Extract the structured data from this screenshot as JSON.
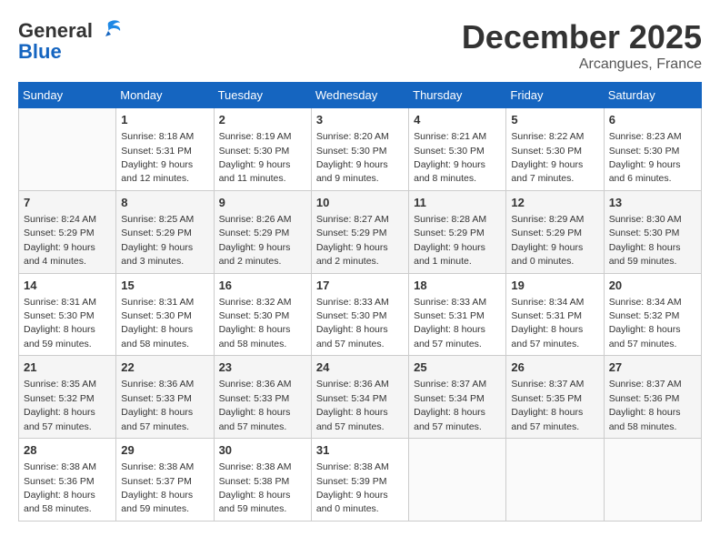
{
  "header": {
    "logo_line1": "General",
    "logo_line2": "Blue",
    "month": "December 2025",
    "location": "Arcangues, France"
  },
  "days_header": [
    "Sunday",
    "Monday",
    "Tuesday",
    "Wednesday",
    "Thursday",
    "Friday",
    "Saturday"
  ],
  "weeks": [
    [
      {
        "day": "",
        "sunrise": "",
        "sunset": "",
        "daylight": ""
      },
      {
        "day": "1",
        "sunrise": "Sunrise: 8:18 AM",
        "sunset": "Sunset: 5:31 PM",
        "daylight": "Daylight: 9 hours and 12 minutes."
      },
      {
        "day": "2",
        "sunrise": "Sunrise: 8:19 AM",
        "sunset": "Sunset: 5:30 PM",
        "daylight": "Daylight: 9 hours and 11 minutes."
      },
      {
        "day": "3",
        "sunrise": "Sunrise: 8:20 AM",
        "sunset": "Sunset: 5:30 PM",
        "daylight": "Daylight: 9 hours and 9 minutes."
      },
      {
        "day": "4",
        "sunrise": "Sunrise: 8:21 AM",
        "sunset": "Sunset: 5:30 PM",
        "daylight": "Daylight: 9 hours and 8 minutes."
      },
      {
        "day": "5",
        "sunrise": "Sunrise: 8:22 AM",
        "sunset": "Sunset: 5:30 PM",
        "daylight": "Daylight: 9 hours and 7 minutes."
      },
      {
        "day": "6",
        "sunrise": "Sunrise: 8:23 AM",
        "sunset": "Sunset: 5:30 PM",
        "daylight": "Daylight: 9 hours and 6 minutes."
      }
    ],
    [
      {
        "day": "7",
        "sunrise": "Sunrise: 8:24 AM",
        "sunset": "Sunset: 5:29 PM",
        "daylight": "Daylight: 9 hours and 4 minutes."
      },
      {
        "day": "8",
        "sunrise": "Sunrise: 8:25 AM",
        "sunset": "Sunset: 5:29 PM",
        "daylight": "Daylight: 9 hours and 3 minutes."
      },
      {
        "day": "9",
        "sunrise": "Sunrise: 8:26 AM",
        "sunset": "Sunset: 5:29 PM",
        "daylight": "Daylight: 9 hours and 2 minutes."
      },
      {
        "day": "10",
        "sunrise": "Sunrise: 8:27 AM",
        "sunset": "Sunset: 5:29 PM",
        "daylight": "Daylight: 9 hours and 2 minutes."
      },
      {
        "day": "11",
        "sunrise": "Sunrise: 8:28 AM",
        "sunset": "Sunset: 5:29 PM",
        "daylight": "Daylight: 9 hours and 1 minute."
      },
      {
        "day": "12",
        "sunrise": "Sunrise: 8:29 AM",
        "sunset": "Sunset: 5:29 PM",
        "daylight": "Daylight: 9 hours and 0 minutes."
      },
      {
        "day": "13",
        "sunrise": "Sunrise: 8:30 AM",
        "sunset": "Sunset: 5:30 PM",
        "daylight": "Daylight: 8 hours and 59 minutes."
      }
    ],
    [
      {
        "day": "14",
        "sunrise": "Sunrise: 8:31 AM",
        "sunset": "Sunset: 5:30 PM",
        "daylight": "Daylight: 8 hours and 59 minutes."
      },
      {
        "day": "15",
        "sunrise": "Sunrise: 8:31 AM",
        "sunset": "Sunset: 5:30 PM",
        "daylight": "Daylight: 8 hours and 58 minutes."
      },
      {
        "day": "16",
        "sunrise": "Sunrise: 8:32 AM",
        "sunset": "Sunset: 5:30 PM",
        "daylight": "Daylight: 8 hours and 58 minutes."
      },
      {
        "day": "17",
        "sunrise": "Sunrise: 8:33 AM",
        "sunset": "Sunset: 5:30 PM",
        "daylight": "Daylight: 8 hours and 57 minutes."
      },
      {
        "day": "18",
        "sunrise": "Sunrise: 8:33 AM",
        "sunset": "Sunset: 5:31 PM",
        "daylight": "Daylight: 8 hours and 57 minutes."
      },
      {
        "day": "19",
        "sunrise": "Sunrise: 8:34 AM",
        "sunset": "Sunset: 5:31 PM",
        "daylight": "Daylight: 8 hours and 57 minutes."
      },
      {
        "day": "20",
        "sunrise": "Sunrise: 8:34 AM",
        "sunset": "Sunset: 5:32 PM",
        "daylight": "Daylight: 8 hours and 57 minutes."
      }
    ],
    [
      {
        "day": "21",
        "sunrise": "Sunrise: 8:35 AM",
        "sunset": "Sunset: 5:32 PM",
        "daylight": "Daylight: 8 hours and 57 minutes."
      },
      {
        "day": "22",
        "sunrise": "Sunrise: 8:36 AM",
        "sunset": "Sunset: 5:33 PM",
        "daylight": "Daylight: 8 hours and 57 minutes."
      },
      {
        "day": "23",
        "sunrise": "Sunrise: 8:36 AM",
        "sunset": "Sunset: 5:33 PM",
        "daylight": "Daylight: 8 hours and 57 minutes."
      },
      {
        "day": "24",
        "sunrise": "Sunrise: 8:36 AM",
        "sunset": "Sunset: 5:34 PM",
        "daylight": "Daylight: 8 hours and 57 minutes."
      },
      {
        "day": "25",
        "sunrise": "Sunrise: 8:37 AM",
        "sunset": "Sunset: 5:34 PM",
        "daylight": "Daylight: 8 hours and 57 minutes."
      },
      {
        "day": "26",
        "sunrise": "Sunrise: 8:37 AM",
        "sunset": "Sunset: 5:35 PM",
        "daylight": "Daylight: 8 hours and 57 minutes."
      },
      {
        "day": "27",
        "sunrise": "Sunrise: 8:37 AM",
        "sunset": "Sunset: 5:36 PM",
        "daylight": "Daylight: 8 hours and 58 minutes."
      }
    ],
    [
      {
        "day": "28",
        "sunrise": "Sunrise: 8:38 AM",
        "sunset": "Sunset: 5:36 PM",
        "daylight": "Daylight: 8 hours and 58 minutes."
      },
      {
        "day": "29",
        "sunrise": "Sunrise: 8:38 AM",
        "sunset": "Sunset: 5:37 PM",
        "daylight": "Daylight: 8 hours and 59 minutes."
      },
      {
        "day": "30",
        "sunrise": "Sunrise: 8:38 AM",
        "sunset": "Sunset: 5:38 PM",
        "daylight": "Daylight: 8 hours and 59 minutes."
      },
      {
        "day": "31",
        "sunrise": "Sunrise: 8:38 AM",
        "sunset": "Sunset: 5:39 PM",
        "daylight": "Daylight: 9 hours and 0 minutes."
      },
      {
        "day": "",
        "sunrise": "",
        "sunset": "",
        "daylight": ""
      },
      {
        "day": "",
        "sunrise": "",
        "sunset": "",
        "daylight": ""
      },
      {
        "day": "",
        "sunrise": "",
        "sunset": "",
        "daylight": ""
      }
    ]
  ]
}
